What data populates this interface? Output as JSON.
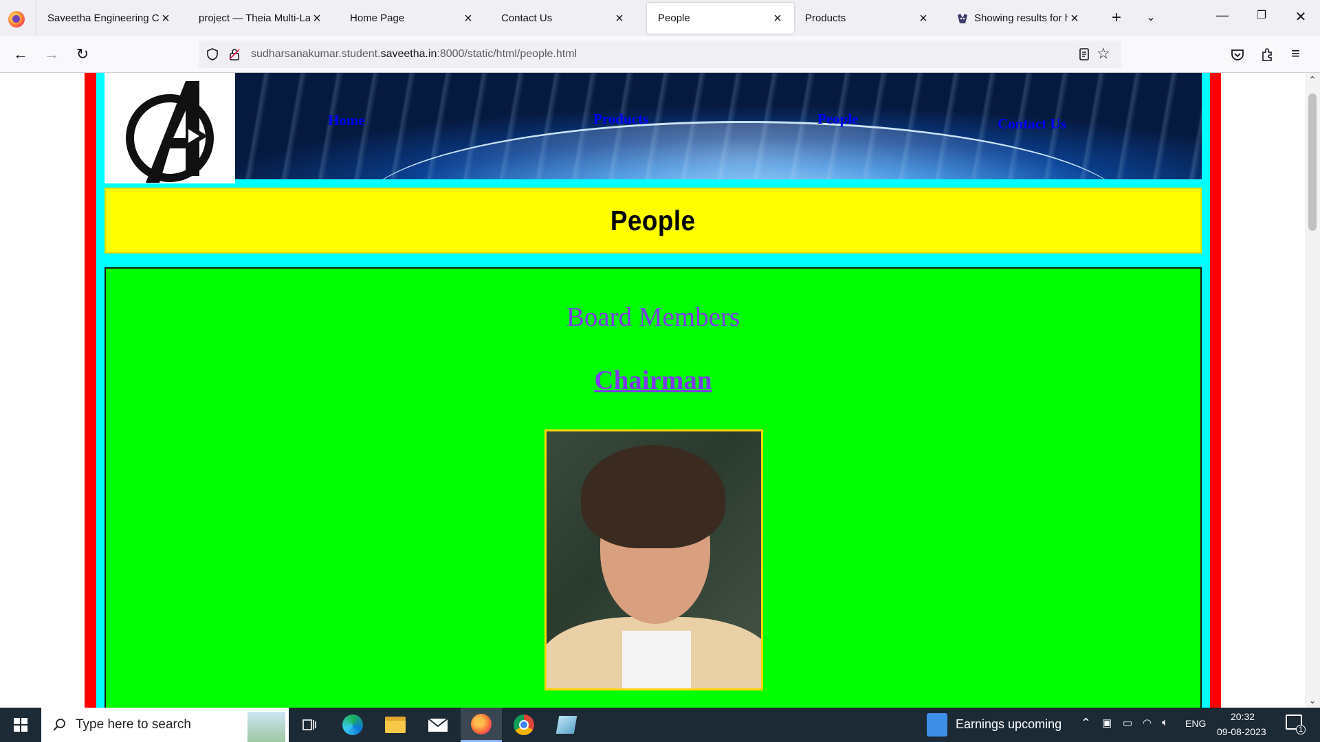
{
  "browser": {
    "tabs": [
      {
        "label": "Saveetha Engineering Coll",
        "active": false
      },
      {
        "label": "project — Theia Multi-Lan",
        "active": false
      },
      {
        "label": "Home Page",
        "active": false
      },
      {
        "label": "Contact Us",
        "active": false
      },
      {
        "label": "People",
        "active": true
      },
      {
        "label": "Products",
        "active": false
      },
      {
        "label": "Showing results for ht",
        "active": false
      }
    ],
    "url": {
      "prefix": "sudharsanakumar.student.",
      "domain": "saveetha.in",
      "suffix": ":8000/static/html/people.html"
    }
  },
  "page": {
    "nav": {
      "home": "Home",
      "products": "Products",
      "people": "People",
      "contact": "Contact Us"
    },
    "title": "People",
    "section_heading": "Board Members",
    "role_heading": "Chairman",
    "colors": {
      "outer_border": "#ff0000",
      "inner_border": "#00ffff",
      "title_bg": "#ffff00",
      "content_bg": "#00ff00",
      "heading_text": "#7c3aed",
      "link_text": "#0000ff",
      "photo_border": "#ffd400"
    }
  },
  "taskbar": {
    "search_placeholder": "Type here to search",
    "news_widget": "Earnings upcoming",
    "language": "ENG",
    "time": "20:32",
    "date": "09-08-2023",
    "notification_count": "1"
  }
}
